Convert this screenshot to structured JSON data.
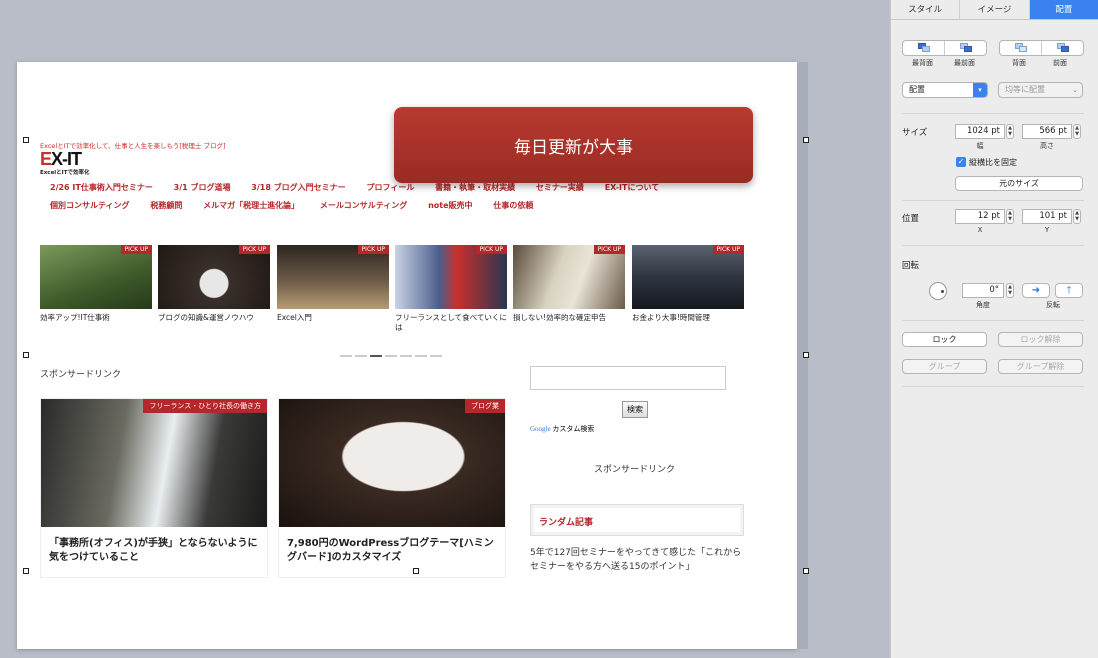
{
  "blog": {
    "tagline": "ExcelとITで効率化して、仕事と人生を楽しもう[税理士 ブログ]",
    "logo_text_a": "E",
    "logo_text_b": "X-IT",
    "logo_sub": "ExcelとITで効率化",
    "nav_row1": [
      "2/26 IT仕事術入門セミナー",
      "3/1 ブログ道場",
      "3/18 ブログ入門セミナー",
      "プロフィール",
      "書籍・執筆・取材実績",
      "セミナー実績",
      "EX-ITについて"
    ],
    "nav_row2": [
      "個別コンサルティング",
      "税務顧問",
      "メルマガ「税理士進化論」",
      "メールコンサルティング",
      "note販売中",
      "仕事の依頼"
    ],
    "pickup_label": "PICK UP",
    "pickups": [
      {
        "caption": "効率アップ!IT仕事術",
        "color": "#4d6b3a"
      },
      {
        "caption": "ブログの知識&運営ノウハウ",
        "color": "#3a2f2a"
      },
      {
        "caption": "Excel入門",
        "color": "#5b4a36"
      },
      {
        "caption": "フリーランスとして食べていくには",
        "color": "#3e4a6b"
      },
      {
        "caption": "損しない!効率的な確定申告",
        "color": "#6b5a4a"
      },
      {
        "caption": "お金より大事!時間管理",
        "color": "#2f3540"
      }
    ],
    "sponsor_left": "スポンサードリンク",
    "cards": [
      {
        "ribbon": "フリーランス・ひとり社長の働き方",
        "title": "「事務所(オフィス)が手狭」とならないように気をつけていること"
      },
      {
        "ribbon": "ブログ業",
        "title": "7,980円のWordPressブログテーマ[ハミングバード]のカスタマイズ"
      }
    ],
    "search_button": "検索",
    "google_label": "Google",
    "google_suffix": "カスタム検索",
    "sponsor_right": "スポンサードリンク",
    "random_heading": "ランダム記事",
    "random_text": "5年で127回セミナーをやってきて感じた「これからセミナーをやる方へ送る15のポイント」"
  },
  "callout": {
    "text": "毎日更新が大事",
    "color": "#a8322a"
  },
  "inspector": {
    "tabs": [
      "スタイル",
      "イメージ",
      "配置"
    ],
    "active_tab": "配置",
    "order_labels": [
      "最背面",
      "最前面",
      "背面",
      "前面"
    ],
    "align_popup": "配置",
    "distribute_popup": "均等に配置",
    "size_label": "サイズ",
    "width_value": "1024 pt",
    "height_value": "566 pt",
    "width_sub": "幅",
    "height_sub": "高さ",
    "lock_ratio_label": "縦横比を固定",
    "original_size_button": "元のサイズ",
    "position_label": "位置",
    "x_value": "12 pt",
    "y_value": "101 pt",
    "x_sub": "X",
    "y_sub": "Y",
    "rotate_label": "回転",
    "angle_value": "0°",
    "angle_sub": "角度",
    "flip_sub": "反転",
    "lock_button": "ロック",
    "unlock_button": "ロック解除",
    "group_button": "グループ",
    "ungroup_button": "グループ解除"
  }
}
